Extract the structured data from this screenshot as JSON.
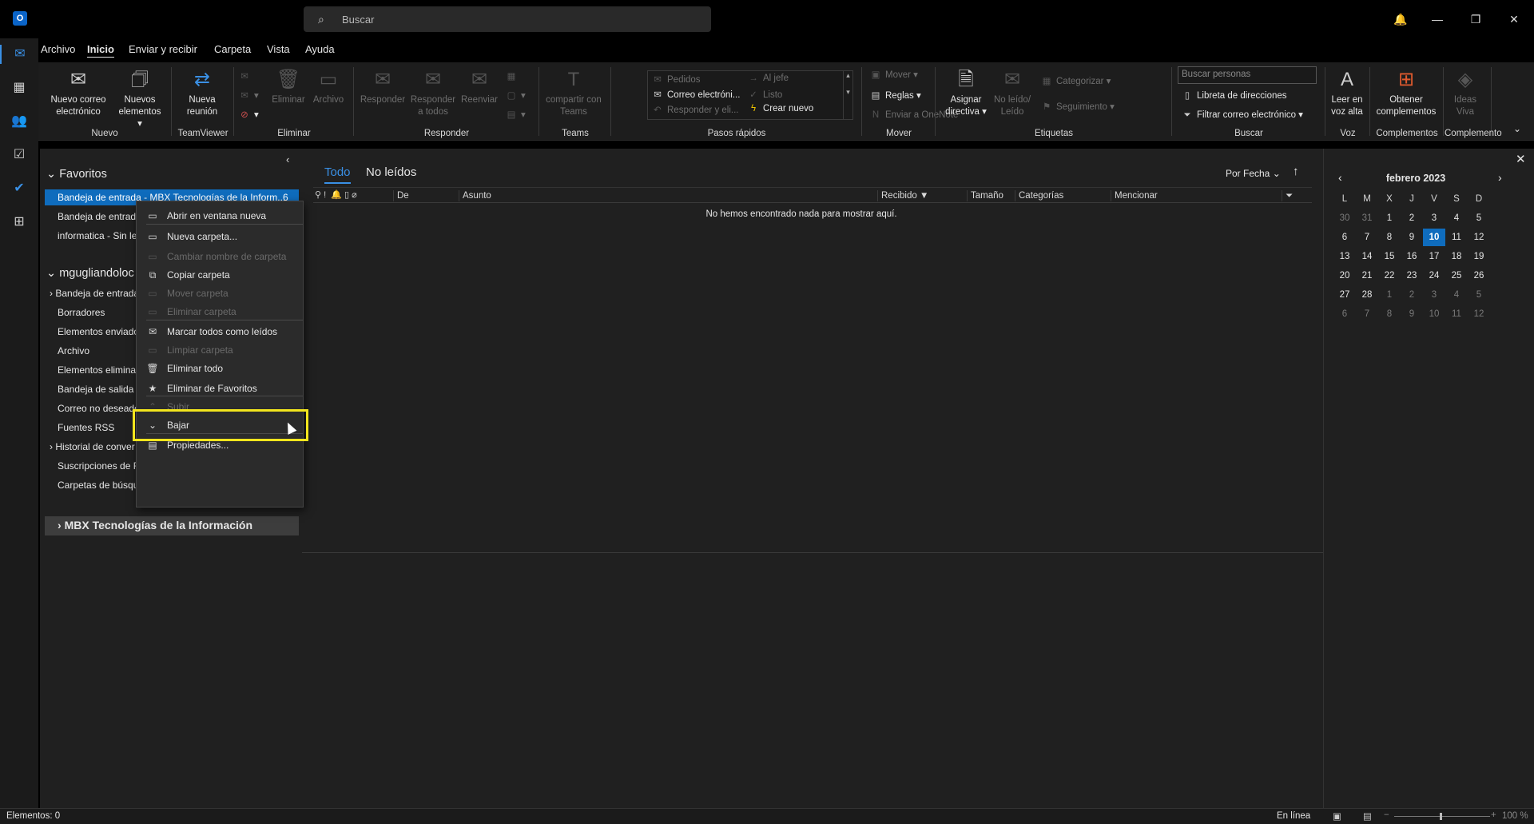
{
  "titlebar": {
    "search_placeholder": "Buscar"
  },
  "menu": [
    "Archivo",
    "Inicio",
    "Enviar y recibir",
    "Carpeta",
    "Vista",
    "Ayuda"
  ],
  "ribbon": {
    "nuevo_correo": "Nuevo correo electrónico",
    "nuevos_elementos": "Nuevos elementos ▾",
    "nueva_reunion": "Nueva reunión",
    "eliminar": "Eliminar",
    "archivo": "Archivo",
    "responder": "Responder",
    "responder_todos": "Responder a todos",
    "reenviar": "Reenviar",
    "compartir_teams": "compartir con Teams",
    "qs_pedidos": "Pedidos",
    "qs_correo": "Correo electróni...",
    "qs_responder": "Responder y eli...",
    "qs_jefe": "Al jefe",
    "qs_listo": "Listo",
    "qs_crear": "Crear nuevo",
    "mover": "Mover ▾",
    "reglas": "Reglas ▾",
    "onenote": "Enviar a OneNote",
    "asignar": "Asignar directiva ▾",
    "noleido": "No leído/ Leído",
    "categorizar": "Categorizar ▾",
    "seguimiento": "Seguimiento ▾",
    "buscar_personas": "Buscar personas",
    "libreta": "Libreta de direcciones",
    "filtrar": "Filtrar correo electrónico ▾",
    "leer_voz": "Leer en voz alta",
    "obtener": "Obtener complementos",
    "ideas": "Ideas Viva",
    "groups": [
      "Nuevo",
      "TeamViewer",
      "Eliminar",
      "Responder",
      "Teams",
      "Pasos rápidos",
      "Mover",
      "Etiquetas",
      "Buscar",
      "Voz",
      "Complementos",
      "Complemento"
    ]
  },
  "folders": {
    "favoritos": "Favoritos",
    "fav_items": [
      {
        "label": "Bandeja de entrada - MBX Tecnologías de la Inform...",
        "count": "6"
      },
      {
        "label": "Bandeja de entrada"
      },
      {
        "label": "informatica - Sin le"
      }
    ],
    "account": "mgugliandoloc",
    "account_items": [
      "Bandeja de entrada",
      "Borradores",
      "Elementos enviado",
      "Archivo",
      "Elementos elimina",
      "Bandeja de salida",
      "Correo no deseado",
      "Fuentes RSS",
      "Historial de conver",
      "Suscripciones de R",
      "Carpetas de búsqu"
    ],
    "mbx": "MBX Tecnologías de la Información"
  },
  "list": {
    "tab_todo": "Todo",
    "tab_noleidos": "No leídos",
    "sort": "Por Fecha",
    "columns": {
      "de": "De",
      "asunto": "Asunto",
      "recibido": "Recibido",
      "tamano": "Tamaño",
      "categorias": "Categorías",
      "mencionar": "Mencionar"
    },
    "empty": "No hemos encontrado nada para mostrar aquí."
  },
  "context_menu": [
    {
      "label": "Abrir en ventana nueva",
      "icon": "open-window-icon",
      "disabled": false
    },
    {
      "label": "Nueva carpeta...",
      "icon": "new-folder-icon",
      "disabled": false
    },
    {
      "label": "Cambiar nombre de carpeta",
      "icon": "rename-icon",
      "disabled": true
    },
    {
      "label": "Copiar carpeta",
      "icon": "copy-folder-icon",
      "disabled": false
    },
    {
      "label": "Mover carpeta",
      "icon": "move-folder-icon",
      "disabled": true
    },
    {
      "label": "Eliminar carpeta",
      "icon": "delete-folder-icon",
      "disabled": true
    },
    {
      "label": "Marcar todos como leídos",
      "icon": "mark-read-icon",
      "disabled": false
    },
    {
      "label": "Limpiar carpeta",
      "icon": "clean-folder-icon",
      "disabled": true
    },
    {
      "label": "Eliminar todo",
      "icon": "delete-all-icon",
      "disabled": false
    },
    {
      "label": "Eliminar de Favoritos",
      "icon": "favorite-remove-icon",
      "disabled": false
    },
    {
      "label": "Subir",
      "icon": "up-icon",
      "disabled": true
    },
    {
      "label": "Bajar",
      "icon": "down-icon",
      "disabled": false
    },
    {
      "label": "Propiedades...",
      "icon": "properties-icon",
      "disabled": false
    }
  ],
  "calendar": {
    "title": "febrero 2023",
    "weekdays": [
      "L",
      "M",
      "X",
      "J",
      "V",
      "S",
      "D"
    ],
    "weeks": [
      [
        "30",
        "31",
        "1",
        "2",
        "3",
        "4",
        "5"
      ],
      [
        "6",
        "7",
        "8",
        "9",
        "10",
        "11",
        "12"
      ],
      [
        "13",
        "14",
        "15",
        "16",
        "17",
        "18",
        "19"
      ],
      [
        "20",
        "21",
        "22",
        "23",
        "24",
        "25",
        "26"
      ],
      [
        "27",
        "28",
        "1",
        "2",
        "3",
        "4",
        "5"
      ],
      [
        "6",
        "7",
        "8",
        "9",
        "10",
        "11",
        "12"
      ]
    ],
    "today": "10"
  },
  "status": {
    "items": "Elementos: 0",
    "online": "En línea",
    "zoom": "100 %"
  }
}
